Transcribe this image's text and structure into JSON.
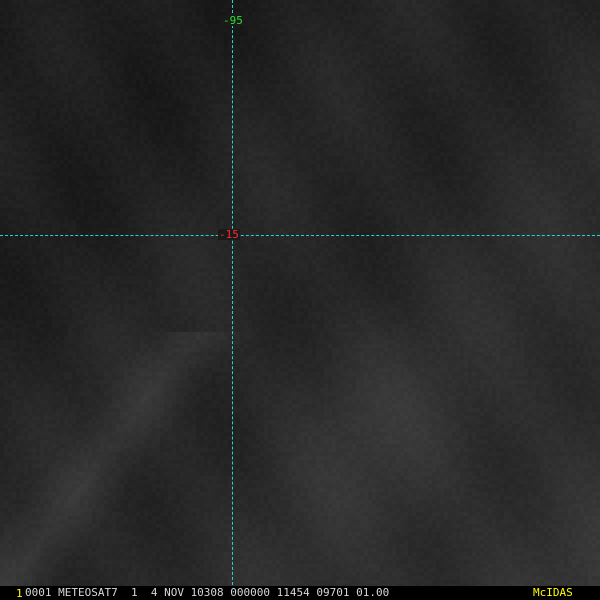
{
  "overlay": {
    "grid_color": "#29d3d3",
    "longitude_label": "-95",
    "longitude_label_color": "#2fe02f",
    "latitude_label": "-15",
    "latitude_label_color": "#ff2a2a"
  },
  "status_bar": {
    "frame_number": "1",
    "frame_number_color": "#ffff00",
    "header_text": "0001 METEOSAT7  1  4 NOV 10308 000000 11454 09701 01.00",
    "brand_label": "McIDAS",
    "brand_color": "#ffff00"
  }
}
